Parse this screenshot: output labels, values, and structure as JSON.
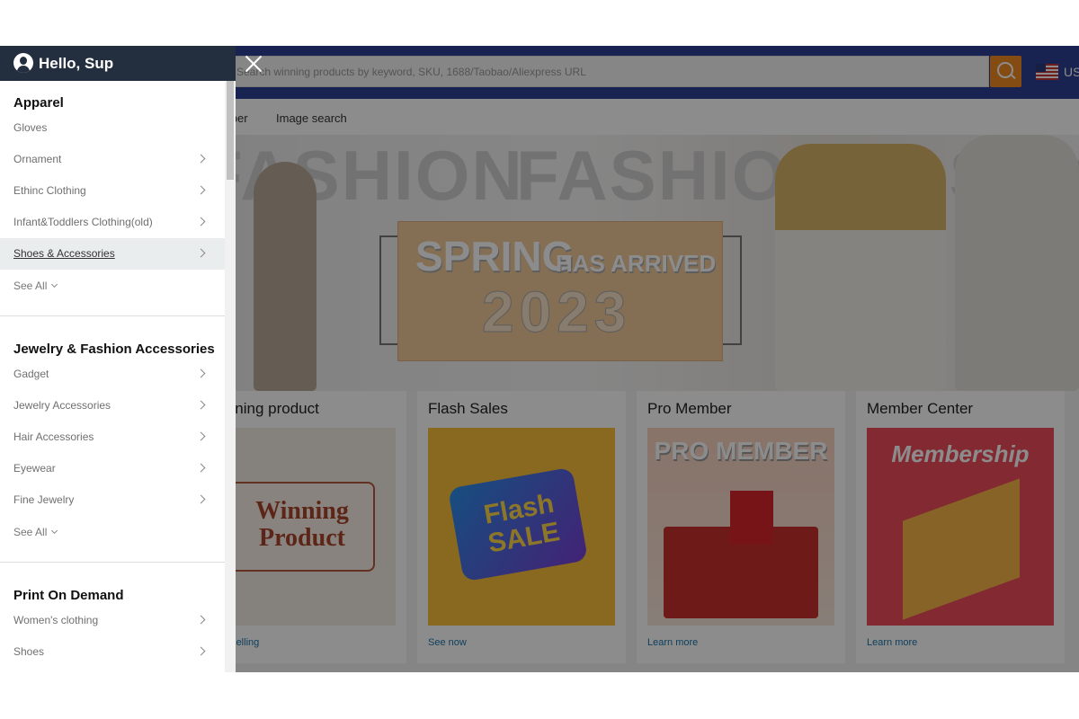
{
  "header": {
    "search_placeholder": "Search winning products by keyword, SKU, 1688/Taobao/Aliexpress URL",
    "language": "US"
  },
  "nav": [
    "Scraper",
    "Image search"
  ],
  "banner": {
    "word": "FASHION",
    "headline": "SPRING",
    "subhead": "HAS ARRIVED",
    "year": "2023"
  },
  "cards": [
    {
      "title": "Winning product",
      "link": "Best selling",
      "image_text": "Winning Product"
    },
    {
      "title": "Flash Sales",
      "link": "See now",
      "image_text": "Flash SALE"
    },
    {
      "title": "Pro Member",
      "link": "Learn more",
      "image_text": "PRO MEMBER"
    },
    {
      "title": "Member Center",
      "link": "Learn more",
      "image_text": "Membership"
    }
  ],
  "sidebar": {
    "greeting": "Hello, Sup",
    "sections": [
      {
        "title": "Apparel",
        "items": [
          {
            "label": "Gloves",
            "chevron": false
          },
          {
            "label": "Ornament",
            "chevron": true
          },
          {
            "label": "Ethinc Clothing",
            "chevron": true
          },
          {
            "label": "Infant&Toddlers Clothing(old)",
            "chevron": true
          },
          {
            "label": "Shoes & Accessories",
            "chevron": true,
            "highlighted": true
          }
        ],
        "see_all": "See All"
      },
      {
        "title": "Jewelry & Fashion Accessories",
        "items": [
          {
            "label": "Gadget",
            "chevron": true
          },
          {
            "label": "Jewelry Accessories",
            "chevron": true
          },
          {
            "label": "Hair Accessories",
            "chevron": true
          },
          {
            "label": "Eyewear",
            "chevron": true
          },
          {
            "label": "Fine Jewelry",
            "chevron": true
          }
        ],
        "see_all": "See All"
      },
      {
        "title": "Print On Demand",
        "items": [
          {
            "label": "Women's clothing",
            "chevron": true
          },
          {
            "label": "Shoes",
            "chevron": true
          }
        ]
      }
    ]
  },
  "colors": {
    "topbar": "#2e4194",
    "search_button": "#f08a24",
    "sidebar_header": "#232f3e",
    "link": "#1a73a8"
  }
}
